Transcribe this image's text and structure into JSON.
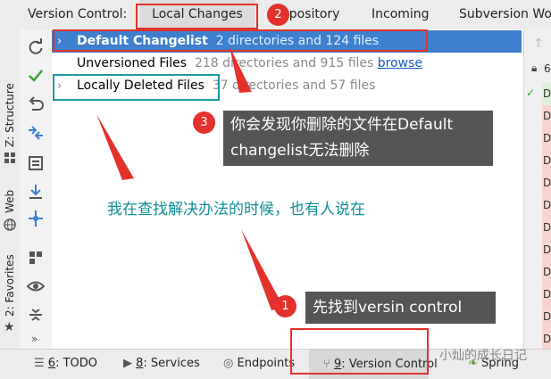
{
  "tabbar": {
    "label": "Version Control:",
    "tabs": [
      {
        "label": "Local Changes"
      },
      {
        "label": "Repository"
      },
      {
        "label": "Incoming"
      },
      {
        "label": "Subversion Wo"
      }
    ]
  },
  "left_strip": {
    "labels": [
      "Z: Structure",
      "Web",
      "2: Favorites"
    ]
  },
  "toolbar": {
    "icons": [
      "refresh-icon",
      "commit-check-icon",
      "rollback-icon",
      "diff-icon",
      "shelve-icon",
      "update-icon",
      "merge-icon",
      "group-icon",
      "eye-icon",
      "collapse-icon",
      "more-icon"
    ]
  },
  "tree": {
    "rows": [
      {
        "name": "Default Changelist",
        "info": "2 directories and 124 files"
      },
      {
        "name": "Unversioned Files",
        "info": "218 directories and 915 files",
        "link": "browse"
      },
      {
        "name": "Locally Deleted Files",
        "info": "37 directories and 57 files"
      }
    ]
  },
  "right_panel": {
    "header": "6",
    "letter": "D"
  },
  "bottombar": {
    "items": [
      {
        "num": "6",
        "label": ": TODO"
      },
      {
        "num": "8",
        "label": ": Services"
      },
      {
        "num": "",
        "label": "Endpoints"
      },
      {
        "num": "9",
        "label": ": Version Control"
      },
      {
        "num": "",
        "label": "Spring"
      }
    ]
  },
  "annotations": {
    "badge1": "1",
    "badge2": "2",
    "badge3": "3",
    "callout1": "先找到versin control",
    "callout3_line1": "你会发现你删除的文件在Default",
    "callout3_line2": "changelist无法删除",
    "note": "我在查找解决办法的时候，也有人说在",
    "watermark": "小灿的成长日记"
  },
  "colors": {
    "selection": "#3e7fce",
    "annotation_red": "#e2322b",
    "annotation_teal": "#1a9aa0",
    "link": "#1a58c9"
  }
}
